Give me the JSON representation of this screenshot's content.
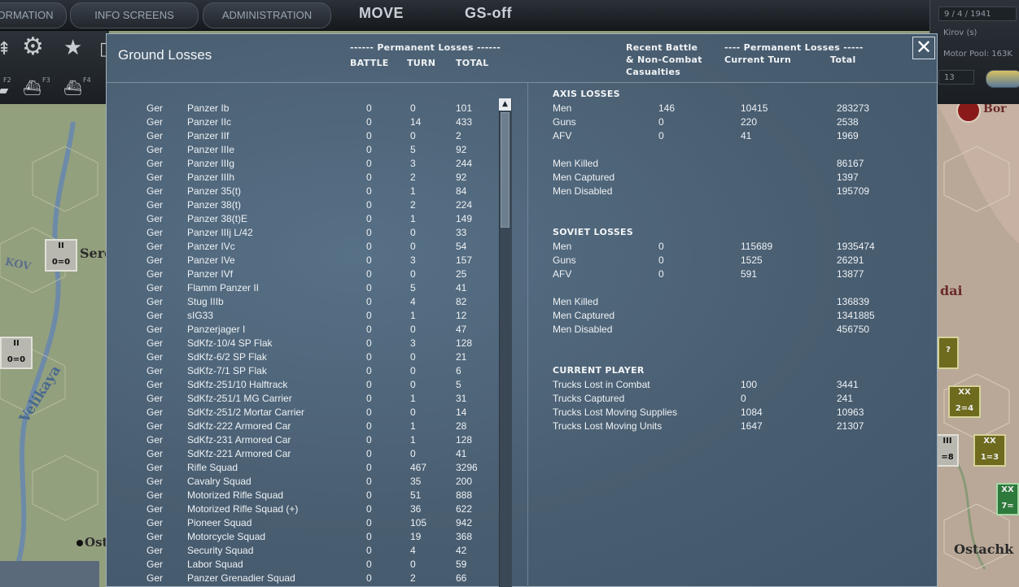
{
  "top_tabs": [
    "ORMATION",
    "INFO SCREENS",
    "ADMINISTRATION"
  ],
  "big_tabs": [
    "MOVE",
    "GS-off"
  ],
  "toolbar_sublabels": [
    "F2",
    "F3",
    "F4"
  ],
  "right_panel": {
    "date": "9 / 4 / 1941",
    "hq": "Kirov (s)",
    "motor_pool": "Motor Pool: 163K",
    "value": "13"
  },
  "map_labels": [
    "Sere",
    "KOV",
    "Velikaya",
    "Ost",
    "dai",
    "Ostachk",
    "Bor"
  ],
  "counters": [
    {
      "top": "II",
      "value": "0=0"
    },
    {
      "top": "II",
      "value": "0=0"
    },
    {
      "top": "XX",
      "value": "2=4"
    },
    {
      "top": "III",
      "value": "=8"
    },
    {
      "top": "XX",
      "value": "1=3"
    },
    {
      "top": "XX",
      "value": "7="
    },
    {
      "top": "",
      "value": "?"
    }
  ],
  "dialog": {
    "title": "Ground Losses",
    "left_header": {
      "group": "------ Permanent Losses ------",
      "battle": "BATTLE",
      "turn": "TURN",
      "total": "TOTAL"
    },
    "right_header": {
      "recent": [
        "Recent Battle",
        "& Non-Combat",
        "Casualties"
      ],
      "group": "---- Permanent Losses -----",
      "current_turn": "Current Turn",
      "total": "Total"
    },
    "close_label": "✕",
    "scroll_up": "▲"
  },
  "units": [
    {
      "nat": "Ger",
      "name": "Panzer Ib",
      "battle": "0",
      "turn": "0",
      "total": "101"
    },
    {
      "nat": "Ger",
      "name": "Panzer IIc",
      "battle": "0",
      "turn": "14",
      "total": "433"
    },
    {
      "nat": "Ger",
      "name": "Panzer IIf",
      "battle": "0",
      "turn": "0",
      "total": "2"
    },
    {
      "nat": "Ger",
      "name": "Panzer IIIe",
      "battle": "0",
      "turn": "5",
      "total": "92"
    },
    {
      "nat": "Ger",
      "name": "Panzer IIIg",
      "battle": "0",
      "turn": "3",
      "total": "244"
    },
    {
      "nat": "Ger",
      "name": "Panzer IIIh",
      "battle": "0",
      "turn": "2",
      "total": "92"
    },
    {
      "nat": "Ger",
      "name": "Panzer 35(t)",
      "battle": "0",
      "turn": "1",
      "total": "84"
    },
    {
      "nat": "Ger",
      "name": "Panzer 38(t)",
      "battle": "0",
      "turn": "2",
      "total": "224"
    },
    {
      "nat": "Ger",
      "name": "Panzer 38(t)E",
      "battle": "0",
      "turn": "1",
      "total": "149"
    },
    {
      "nat": "Ger",
      "name": "Panzer IIIj L/42",
      "battle": "0",
      "turn": "0",
      "total": "33"
    },
    {
      "nat": "Ger",
      "name": "Panzer IVc",
      "battle": "0",
      "turn": "0",
      "total": "54"
    },
    {
      "nat": "Ger",
      "name": "Panzer IVe",
      "battle": "0",
      "turn": "3",
      "total": "157"
    },
    {
      "nat": "Ger",
      "name": "Panzer IVf",
      "battle": "0",
      "turn": "0",
      "total": "25"
    },
    {
      "nat": "Ger",
      "name": "Flamm Panzer II",
      "battle": "0",
      "turn": "5",
      "total": "41"
    },
    {
      "nat": "Ger",
      "name": "Stug IIIb",
      "battle": "0",
      "turn": "4",
      "total": "82"
    },
    {
      "nat": "Ger",
      "name": "sIG33",
      "battle": "0",
      "turn": "1",
      "total": "12"
    },
    {
      "nat": "Ger",
      "name": "Panzerjager I",
      "battle": "0",
      "turn": "0",
      "total": "47"
    },
    {
      "nat": "Ger",
      "name": "SdKfz-10/4 SP Flak",
      "battle": "0",
      "turn": "3",
      "total": "128"
    },
    {
      "nat": "Ger",
      "name": "SdKfz-6/2 SP Flak",
      "battle": "0",
      "turn": "0",
      "total": "21"
    },
    {
      "nat": "Ger",
      "name": "SdKfz-7/1 SP Flak",
      "battle": "0",
      "turn": "0",
      "total": "6"
    },
    {
      "nat": "Ger",
      "name": "SdKfz-251/10 Halftrack",
      "battle": "0",
      "turn": "0",
      "total": "5"
    },
    {
      "nat": "Ger",
      "name": "SdKfz-251/1 MG Carrier",
      "battle": "0",
      "turn": "1",
      "total": "31"
    },
    {
      "nat": "Ger",
      "name": "SdKfz-251/2 Mortar Carrier",
      "battle": "0",
      "turn": "0",
      "total": "14"
    },
    {
      "nat": "Ger",
      "name": "SdKfz-222 Armored Car",
      "battle": "0",
      "turn": "1",
      "total": "28"
    },
    {
      "nat": "Ger",
      "name": "SdKfz-231 Armored Car",
      "battle": "0",
      "turn": "1",
      "total": "128"
    },
    {
      "nat": "Ger",
      "name": "SdKfz-221 Armored Car",
      "battle": "0",
      "turn": "0",
      "total": "41"
    },
    {
      "nat": "Ger",
      "name": "Rifle Squad",
      "battle": "0",
      "turn": "467",
      "total": "3296"
    },
    {
      "nat": "Ger",
      "name": "Cavalry Squad",
      "battle": "0",
      "turn": "35",
      "total": "200"
    },
    {
      "nat": "Ger",
      "name": "Motorized Rifle Squad",
      "battle": "0",
      "turn": "51",
      "total": "888"
    },
    {
      "nat": "Ger",
      "name": "Motorized Rifle Squad (+)",
      "battle": "0",
      "turn": "36",
      "total": "622"
    },
    {
      "nat": "Ger",
      "name": "Pioneer Squad",
      "battle": "0",
      "turn": "105",
      "total": "942"
    },
    {
      "nat": "Ger",
      "name": "Motorcycle Squad",
      "battle": "0",
      "turn": "19",
      "total": "368"
    },
    {
      "nat": "Ger",
      "name": "Security Squad",
      "battle": "0",
      "turn": "4",
      "total": "42"
    },
    {
      "nat": "Ger",
      "name": "Labor Squad",
      "battle": "0",
      "turn": "0",
      "total": "59"
    },
    {
      "nat": "Ger",
      "name": "Panzer Grenadier Squad",
      "battle": "0",
      "turn": "2",
      "total": "66"
    }
  ],
  "axis": {
    "title": "AXIS LOSSES",
    "rows": [
      {
        "label": "Men",
        "recent": "146",
        "current": "10415",
        "total": "283273"
      },
      {
        "label": "Guns",
        "recent": "0",
        "current": "220",
        "total": "2538"
      },
      {
        "label": "AFV",
        "recent": "0",
        "current": "41",
        "total": "1969"
      }
    ],
    "details": [
      {
        "label": "Men Killed",
        "total": "86167"
      },
      {
        "label": "Men Captured",
        "total": "1397"
      },
      {
        "label": "Men Disabled",
        "total": "195709"
      }
    ]
  },
  "soviet": {
    "title": "SOVIET LOSSES",
    "rows": [
      {
        "label": "Men",
        "recent": "0",
        "current": "115689",
        "total": "1935474"
      },
      {
        "label": "Guns",
        "recent": "0",
        "current": "1525",
        "total": "26291"
      },
      {
        "label": "AFV",
        "recent": "0",
        "current": "591",
        "total": "13877"
      }
    ],
    "details": [
      {
        "label": "Men Killed",
        "total": "136839"
      },
      {
        "label": "Men Captured",
        "total": "1341885"
      },
      {
        "label": "Men Disabled",
        "total": "456750"
      }
    ]
  },
  "current_player": {
    "title": "CURRENT PLAYER",
    "rows": [
      {
        "label": "Trucks Lost in Combat",
        "current": "100",
        "total": "3441"
      },
      {
        "label": "Trucks Captured",
        "current": "0",
        "total": "241"
      },
      {
        "label": "Trucks Lost Moving Supplies",
        "current": "1084",
        "total": "10963"
      },
      {
        "label": "Trucks Lost Moving Units",
        "current": "1647",
        "total": "21307"
      }
    ]
  }
}
